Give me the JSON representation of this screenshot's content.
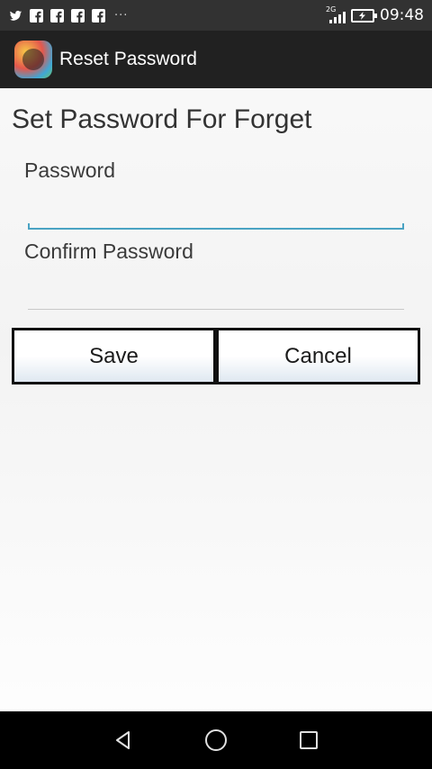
{
  "status_bar": {
    "notification_icons": [
      "twitter-icon",
      "facebook-icon",
      "facebook-icon",
      "facebook-icon",
      "facebook-icon"
    ],
    "overflow": "···",
    "network_type": "2G",
    "time": "09:48"
  },
  "action_bar": {
    "title": "Reset Password"
  },
  "form": {
    "heading": "Set Password For Forget",
    "password_label": "Password",
    "password_value": "",
    "confirm_label": "Confirm Password",
    "confirm_value": "",
    "save_label": "Save",
    "cancel_label": "Cancel"
  },
  "colors": {
    "status_bar": "#323232",
    "action_bar": "#212121",
    "focus_accent": "#4aa3c3",
    "nav_bar": "#000000"
  },
  "nav_bar": {
    "buttons": [
      "back-icon",
      "home-icon",
      "recents-icon"
    ]
  }
}
